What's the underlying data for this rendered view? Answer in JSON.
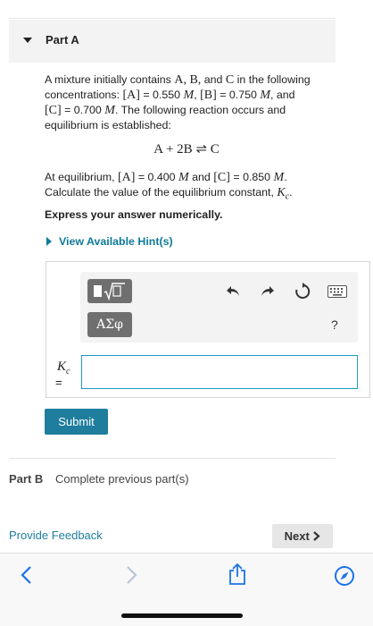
{
  "partA": {
    "title": "Part A",
    "line1": "A mixture initially contains",
    "line1_species": "A, B,",
    "line1_and": "and",
    "line1_c": "C",
    "line1_end": "in the following",
    "line2_start": "concentrations:",
    "conc_A_label": "[A]",
    "conc_A_value": "= 0.550",
    "conc_B_label": "[B]",
    "conc_B_value": "= 0.750",
    "conc_C_label": "[C]",
    "conc_C_value": "= 0.700",
    "unit_M": "M",
    "and_word": ", and",
    "line3_rest": ". The following reaction occurs and",
    "line4": "equilibrium is established:",
    "reaction_left": "A + 2B",
    "reaction_arrow": "⇌",
    "reaction_right": "C",
    "eq_start": "At equilibrium,",
    "eq_A_label": "[A]",
    "eq_A_value": "= 0.400",
    "eq_and": "and",
    "eq_C_label": "[C]",
    "eq_C_value": "= 0.850",
    "eq_line2": "Calculate the value of the equilibrium constant,",
    "kc_symbol": "K",
    "kc_sub": "c",
    "express": "Express your answer numerically.",
    "hint_link": "View Available Hint(s)"
  },
  "toolbar": {
    "greek_label": "ΑΣφ",
    "help_label": "?",
    "icons": [
      "template-icon",
      "undo-icon",
      "redo-icon",
      "reset-icon",
      "keyboard-icon"
    ]
  },
  "answer": {
    "label_symbol": "K",
    "label_sub": "c",
    "equals": "=",
    "value": "",
    "submit_label": "Submit"
  },
  "partB": {
    "label": "Part B",
    "status": "Complete previous part(s)"
  },
  "footer": {
    "feedback_label": "Provide Feedback",
    "next_label": "Next"
  },
  "colors": {
    "accent": "#1f7e9e",
    "link": "#0f7a9b",
    "input_border": "#1e9bc6",
    "browser_blue": "#1a73e8"
  }
}
